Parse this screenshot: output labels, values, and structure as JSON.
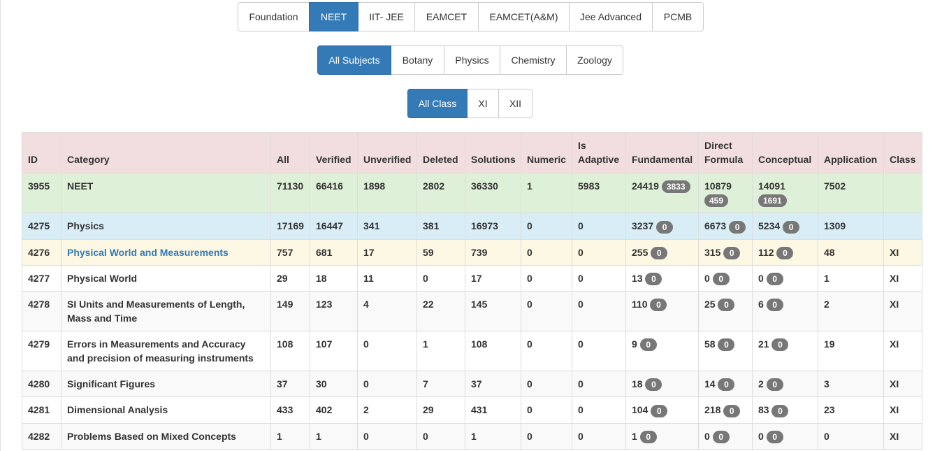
{
  "exam_tabs": [
    {
      "label": "Foundation",
      "active": false
    },
    {
      "label": "NEET",
      "active": true
    },
    {
      "label": "IIT- JEE",
      "active": false
    },
    {
      "label": "EAMCET",
      "active": false
    },
    {
      "label": "EAMCET(A&M)",
      "active": false
    },
    {
      "label": "Jee Advanced",
      "active": false
    },
    {
      "label": "PCMB",
      "active": false
    }
  ],
  "subject_tabs": [
    {
      "label": "All Subjects",
      "active": true
    },
    {
      "label": "Botany",
      "active": false
    },
    {
      "label": "Physics",
      "active": false
    },
    {
      "label": "Chemistry",
      "active": false
    },
    {
      "label": "Zoology",
      "active": false
    }
  ],
  "class_tabs": [
    {
      "label": "All Class",
      "active": true
    },
    {
      "label": "XI",
      "active": false
    },
    {
      "label": "XII",
      "active": false
    }
  ],
  "colors": {
    "primary": "#337ab7",
    "header_bg": "#f2dede",
    "success_bg": "#dff0d8",
    "info_bg": "#d9edf7",
    "warning_bg": "#fcf8e3",
    "badge_bg": "#777777"
  },
  "table": {
    "headers": [
      "ID",
      "Category",
      "All",
      "Verified",
      "Unverified",
      "Deleted",
      "Solutions",
      "Numeric",
      "Is Adaptive",
      "Fundamental",
      "Direct Formula",
      "Conceptual",
      "Application",
      "Class"
    ],
    "rows": [
      {
        "id": "3955",
        "category": "NEET",
        "link": false,
        "all": "71130",
        "verified": "66416",
        "unverified": "1898",
        "deleted": "2802",
        "solutions": "36330",
        "numeric": "1",
        "is_adaptive": "5983",
        "fundamental": "24419",
        "fundamental_badge": "3833",
        "direct_formula": "10879",
        "direct_formula_badge": "459",
        "conceptual": "14091",
        "conceptual_badge": "1691",
        "application": "7502",
        "class": "",
        "style": "green"
      },
      {
        "id": "4275",
        "category": "Physics",
        "link": false,
        "all": "17169",
        "verified": "16447",
        "unverified": "341",
        "deleted": "381",
        "solutions": "16973",
        "numeric": "0",
        "is_adaptive": "0",
        "fundamental": "3237",
        "fundamental_badge": "0",
        "direct_formula": "6673",
        "direct_formula_badge": "0",
        "conceptual": "5234",
        "conceptual_badge": "0",
        "application": "1309",
        "class": "",
        "style": "blue"
      },
      {
        "id": "4276",
        "category": "Physical World and Measurements",
        "link": true,
        "all": "757",
        "verified": "681",
        "unverified": "17",
        "deleted": "59",
        "solutions": "739",
        "numeric": "0",
        "is_adaptive": "0",
        "fundamental": "255",
        "fundamental_badge": "0",
        "direct_formula": "315",
        "direct_formula_badge": "0",
        "conceptual": "112",
        "conceptual_badge": "0",
        "application": "48",
        "class": "XI",
        "style": "yellow"
      },
      {
        "id": "4277",
        "category": "Physical World",
        "link": false,
        "all": "29",
        "verified": "18",
        "unverified": "11",
        "deleted": "0",
        "solutions": "17",
        "numeric": "0",
        "is_adaptive": "0",
        "fundamental": "13",
        "fundamental_badge": "0",
        "direct_formula": "0",
        "direct_formula_badge": "0",
        "conceptual": "0",
        "conceptual_badge": "0",
        "application": "1",
        "class": "XI",
        "style": "white"
      },
      {
        "id": "4278",
        "category": "SI Units and Measurements of Length, Mass and Time",
        "link": false,
        "all": "149",
        "verified": "123",
        "unverified": "4",
        "deleted": "22",
        "solutions": "145",
        "numeric": "0",
        "is_adaptive": "0",
        "fundamental": "110",
        "fundamental_badge": "0",
        "direct_formula": "25",
        "direct_formula_badge": "0",
        "conceptual": "6",
        "conceptual_badge": "0",
        "application": "2",
        "class": "XI",
        "style": "stripe"
      },
      {
        "id": "4279",
        "category": "Errors in Measurements and Accuracy and precision of measuring instruments",
        "link": false,
        "all": "108",
        "verified": "107",
        "unverified": "0",
        "deleted": "1",
        "solutions": "108",
        "numeric": "0",
        "is_adaptive": "0",
        "fundamental": "9",
        "fundamental_badge": "0",
        "direct_formula": "58",
        "direct_formula_badge": "0",
        "conceptual": "21",
        "conceptual_badge": "0",
        "application": "19",
        "class": "XI",
        "style": "white"
      },
      {
        "id": "4280",
        "category": "Significant Figures",
        "link": false,
        "all": "37",
        "verified": "30",
        "unverified": "0",
        "deleted": "7",
        "solutions": "37",
        "numeric": "0",
        "is_adaptive": "0",
        "fundamental": "18",
        "fundamental_badge": "0",
        "direct_formula": "14",
        "direct_formula_badge": "0",
        "conceptual": "2",
        "conceptual_badge": "0",
        "application": "3",
        "class": "XI",
        "style": "stripe"
      },
      {
        "id": "4281",
        "category": "Dimensional Analysis",
        "link": false,
        "all": "433",
        "verified": "402",
        "unverified": "2",
        "deleted": "29",
        "solutions": "431",
        "numeric": "0",
        "is_adaptive": "0",
        "fundamental": "104",
        "fundamental_badge": "0",
        "direct_formula": "218",
        "direct_formula_badge": "0",
        "conceptual": "83",
        "conceptual_badge": "0",
        "application": "23",
        "class": "XI",
        "style": "white"
      },
      {
        "id": "4282",
        "category": "Problems Based on Mixed Concepts",
        "link": false,
        "all": "1",
        "verified": "1",
        "unverified": "0",
        "deleted": "0",
        "solutions": "1",
        "numeric": "0",
        "is_adaptive": "0",
        "fundamental": "1",
        "fundamental_badge": "0",
        "direct_formula": "0",
        "direct_formula_badge": "0",
        "conceptual": "0",
        "conceptual_badge": "0",
        "application": "0",
        "class": "XI",
        "style": "stripe"
      }
    ]
  }
}
